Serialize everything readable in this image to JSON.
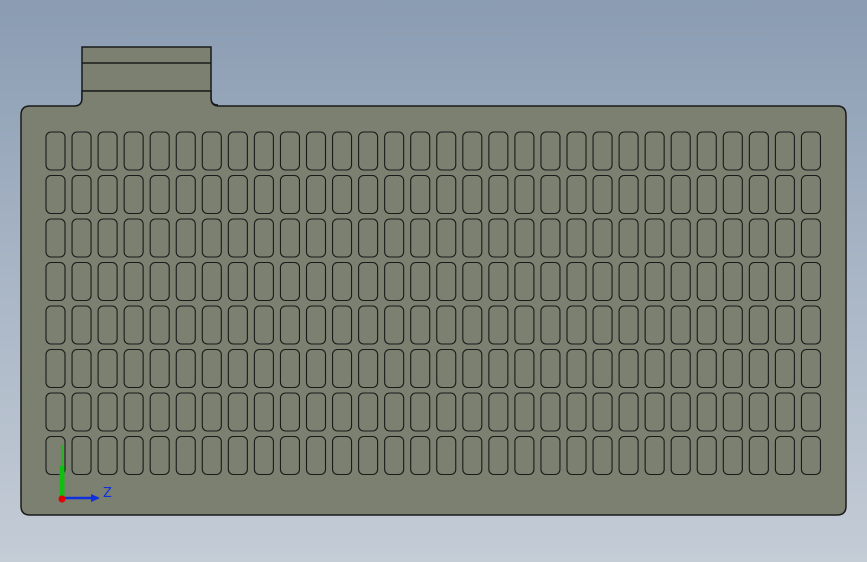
{
  "model": {
    "part_fill": "#7b8070",
    "edge_color": "#1a1a1a",
    "slot_rows": 8,
    "slot_columns": 30
  },
  "triad": {
    "z_label": "Z",
    "colors": {
      "x": "#e00000",
      "y": "#10c010",
      "z": "#1030e0"
    }
  },
  "background": {
    "top": "#8a9cb2",
    "bottom": "#c4ccd6"
  }
}
